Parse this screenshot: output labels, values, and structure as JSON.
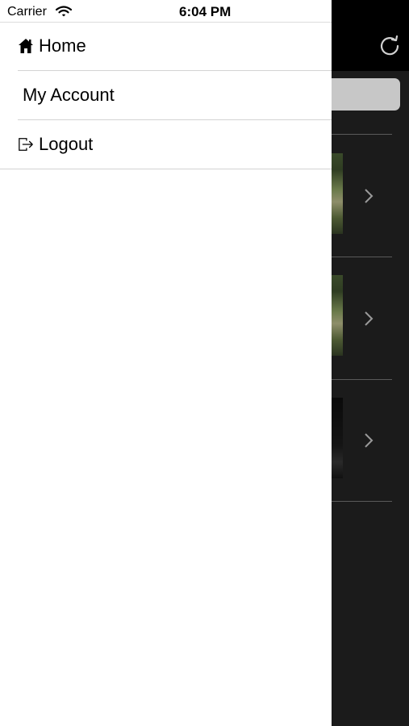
{
  "status_bar": {
    "carrier": "Carrier",
    "time": "6:04 PM"
  },
  "menu": {
    "items": [
      {
        "label": "Home",
        "icon": "home-icon"
      },
      {
        "label": "My Account",
        "icon": ""
      },
      {
        "label": "Logout",
        "icon": "logout-icon"
      }
    ]
  },
  "colors": {
    "drawer_bg": "#ffffff",
    "app_bg": "#1b1b1b",
    "header_bg": "#000000",
    "separator": "#d3d3d3"
  }
}
